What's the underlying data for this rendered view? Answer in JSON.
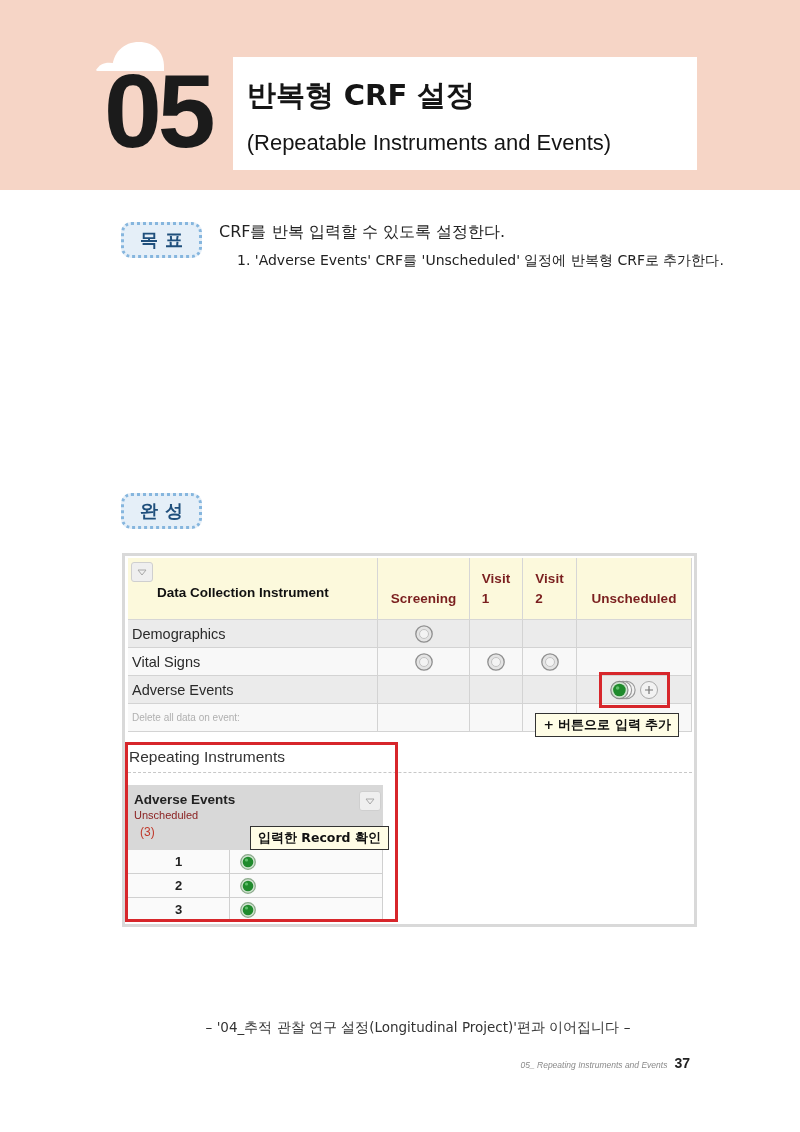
{
  "chapter": {
    "number": "05",
    "title": "반복형 CRF 설정",
    "subtitle": "(Repeatable Instruments and Events)"
  },
  "goal": {
    "badge": "목 표",
    "text": "CRF를 반복 입력할 수 있도록 설정한다.",
    "steps": [
      "1. 'Adverse Events' CRF를 'Unscheduled' 일정에 반복형 CRF로 추가한다."
    ]
  },
  "result": {
    "badge": "완 성"
  },
  "screenshot": {
    "event_grid": {
      "columns": [
        {
          "label": "Data Collection Instrument",
          "kind": "instrument"
        },
        {
          "label": "Screening",
          "kind": "event"
        },
        {
          "label": "Visit 1",
          "kind": "event"
        },
        {
          "label": "Visit 2",
          "kind": "event"
        },
        {
          "label": "Unscheduled",
          "kind": "event"
        }
      ],
      "rows": [
        {
          "name": "Demographics",
          "cells": [
            {
              "kind": "unstarted",
              "add_button": false,
              "highlighted": false
            },
            {
              "kind": "blank",
              "add_button": false,
              "highlighted": false
            },
            {
              "kind": "blank",
              "add_button": false,
              "highlighted": false
            },
            {
              "kind": "blank",
              "add_button": false,
              "highlighted": false
            }
          ]
        },
        {
          "name": "Vital Signs",
          "cells": [
            {
              "kind": "unstarted",
              "add_button": false,
              "highlighted": false
            },
            {
              "kind": "unstarted",
              "add_button": false,
              "highlighted": false
            },
            {
              "kind": "unstarted",
              "add_button": false,
              "highlighted": false
            },
            {
              "kind": "blank",
              "add_button": false,
              "highlighted": false
            }
          ]
        },
        {
          "name": "Adverse Events",
          "cells": [
            {
              "kind": "blank",
              "add_button": false,
              "highlighted": false
            },
            {
              "kind": "blank",
              "add_button": false,
              "highlighted": false
            },
            {
              "kind": "blank",
              "add_button": false,
              "highlighted": false
            },
            {
              "kind": "stacked",
              "add_button": true,
              "highlighted": true
            }
          ]
        }
      ],
      "delete_label": "Delete all data on event:",
      "callout": "+ 버튼으로 입력 추가"
    },
    "repeating": {
      "title": "Repeating Instruments",
      "highlighted": true,
      "instrument": "Adverse Events",
      "event": "Unscheduled",
      "count": "(3)",
      "callout": "입력한 Record 확인",
      "instances": [
        {
          "number": "1",
          "kind": "complete"
        },
        {
          "number": "2",
          "kind": "complete"
        },
        {
          "number": "3",
          "kind": "complete"
        }
      ]
    }
  },
  "continuation": "– '04_추적 관찰 연구 설정(Longitudinal Project)'편과 이어집니다 –",
  "page_footer": {
    "section": "05_ Repeating Instruments and Events",
    "page": "37"
  }
}
